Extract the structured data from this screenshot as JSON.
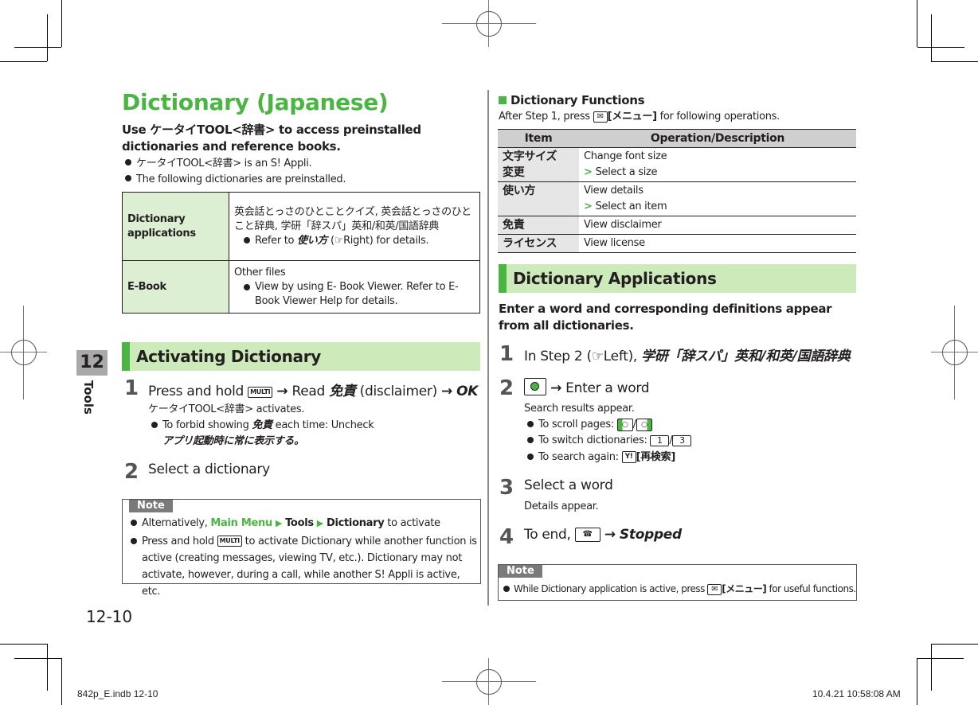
{
  "page": {
    "title": "Dictionary (Japanese)",
    "lead": "Use ケータイTOOL<辞書> to access preinstalled dictionaries and reference books.",
    "bullets": [
      "ケータイTOOL<辞書> is an S! Appli.",
      "The following dictionaries are preinstalled."
    ],
    "chapter_number": "12",
    "chapter_label": "Tools",
    "page_number": "12-10",
    "slug_left": "842p_E.indb   12-10",
    "slug_right": "10.4.21   10:58:08 AM"
  },
  "apps_table": {
    "rows": [
      {
        "header": "Dictionary applications",
        "text": "英会話とっさのひとことクイズ, 英会話とっさのひとこと辞典, 学研「辞スパ」英和/和英/国語辞典",
        "bullet_pre": "Refer to ",
        "bullet_em": "使い方",
        "bullet_ref": "(☞Right) for details."
      },
      {
        "header": "E-Book",
        "text": "Other files",
        "bullet": "View by using E- Book Viewer. Refer to E-Book Viewer Help for details."
      }
    ]
  },
  "activating": {
    "heading": "Activating Dictionary",
    "steps": [
      {
        "num": "1",
        "pre": "Press and hold",
        "key": "MULTI",
        "mid": "Read",
        "em": "免責",
        "post": "(disclaimer)",
        "end": "OK",
        "sub": "ケータイTOOL<辞書> activates.",
        "bullet_pre": "To forbid showing",
        "bullet_em": "免責",
        "bullet_post": "each time: Uncheck",
        "bullet_em2": "アプリ起動時に常に表示する。"
      },
      {
        "num": "2",
        "text": "Select a dictionary"
      }
    ],
    "note": {
      "label": "Note",
      "item1": {
        "pre": "Alternatively,",
        "menu": "Main Menu",
        "p1": "Tools",
        "p2": "Dictionary",
        "post": "to activate"
      },
      "item2": {
        "pre": "Press and hold",
        "key": "MULTI",
        "post": "to activate Dictionary while another function is active (creating messages, viewing TV, etc.). Dictionary may not activate, however, during a call, while another S! Appli is active, etc."
      }
    }
  },
  "functions": {
    "heading": "Dictionary Functions",
    "intro_pre": "After Step 1, press",
    "intro_key": "[メニュー]",
    "intro_post": "for following operations.",
    "columns": [
      "Item",
      "Operation/Description"
    ],
    "rows": [
      {
        "item": "文字サイズ変更",
        "desc": "Change font size",
        "sub": "Select a size"
      },
      {
        "item": "使い方",
        "desc": "View details",
        "sub": "Select an item"
      },
      {
        "item": "免責",
        "desc": "View disclaimer",
        "sub": ""
      },
      {
        "item": "ライセンス",
        "desc": "View license",
        "sub": ""
      }
    ]
  },
  "applications": {
    "heading": "Dictionary Applications",
    "lead": "Enter a word and corresponding definitions appear from all dictionaries.",
    "steps": [
      {
        "num": "1",
        "pre": "In Step 2 (☞Left),",
        "em": "学研「辞スパ」英和/和英/国語辞典"
      },
      {
        "num": "2",
        "text": "Enter a word",
        "sub": "Search results appear.",
        "b1": "To scroll pages:",
        "b2": "To switch dictionaries:",
        "b2k1": "1",
        "b2k2": "3",
        "b3": "To search again:",
        "b3k": "[再検索]"
      },
      {
        "num": "3",
        "text": "Select a word",
        "sub": "Details appear."
      },
      {
        "num": "4",
        "pre": "To end,",
        "em": "Stopped"
      }
    ],
    "note": {
      "label": "Note",
      "pre": "While Dictionary application is active, press",
      "key": "[メニュー]",
      "post": "for useful functions."
    }
  }
}
